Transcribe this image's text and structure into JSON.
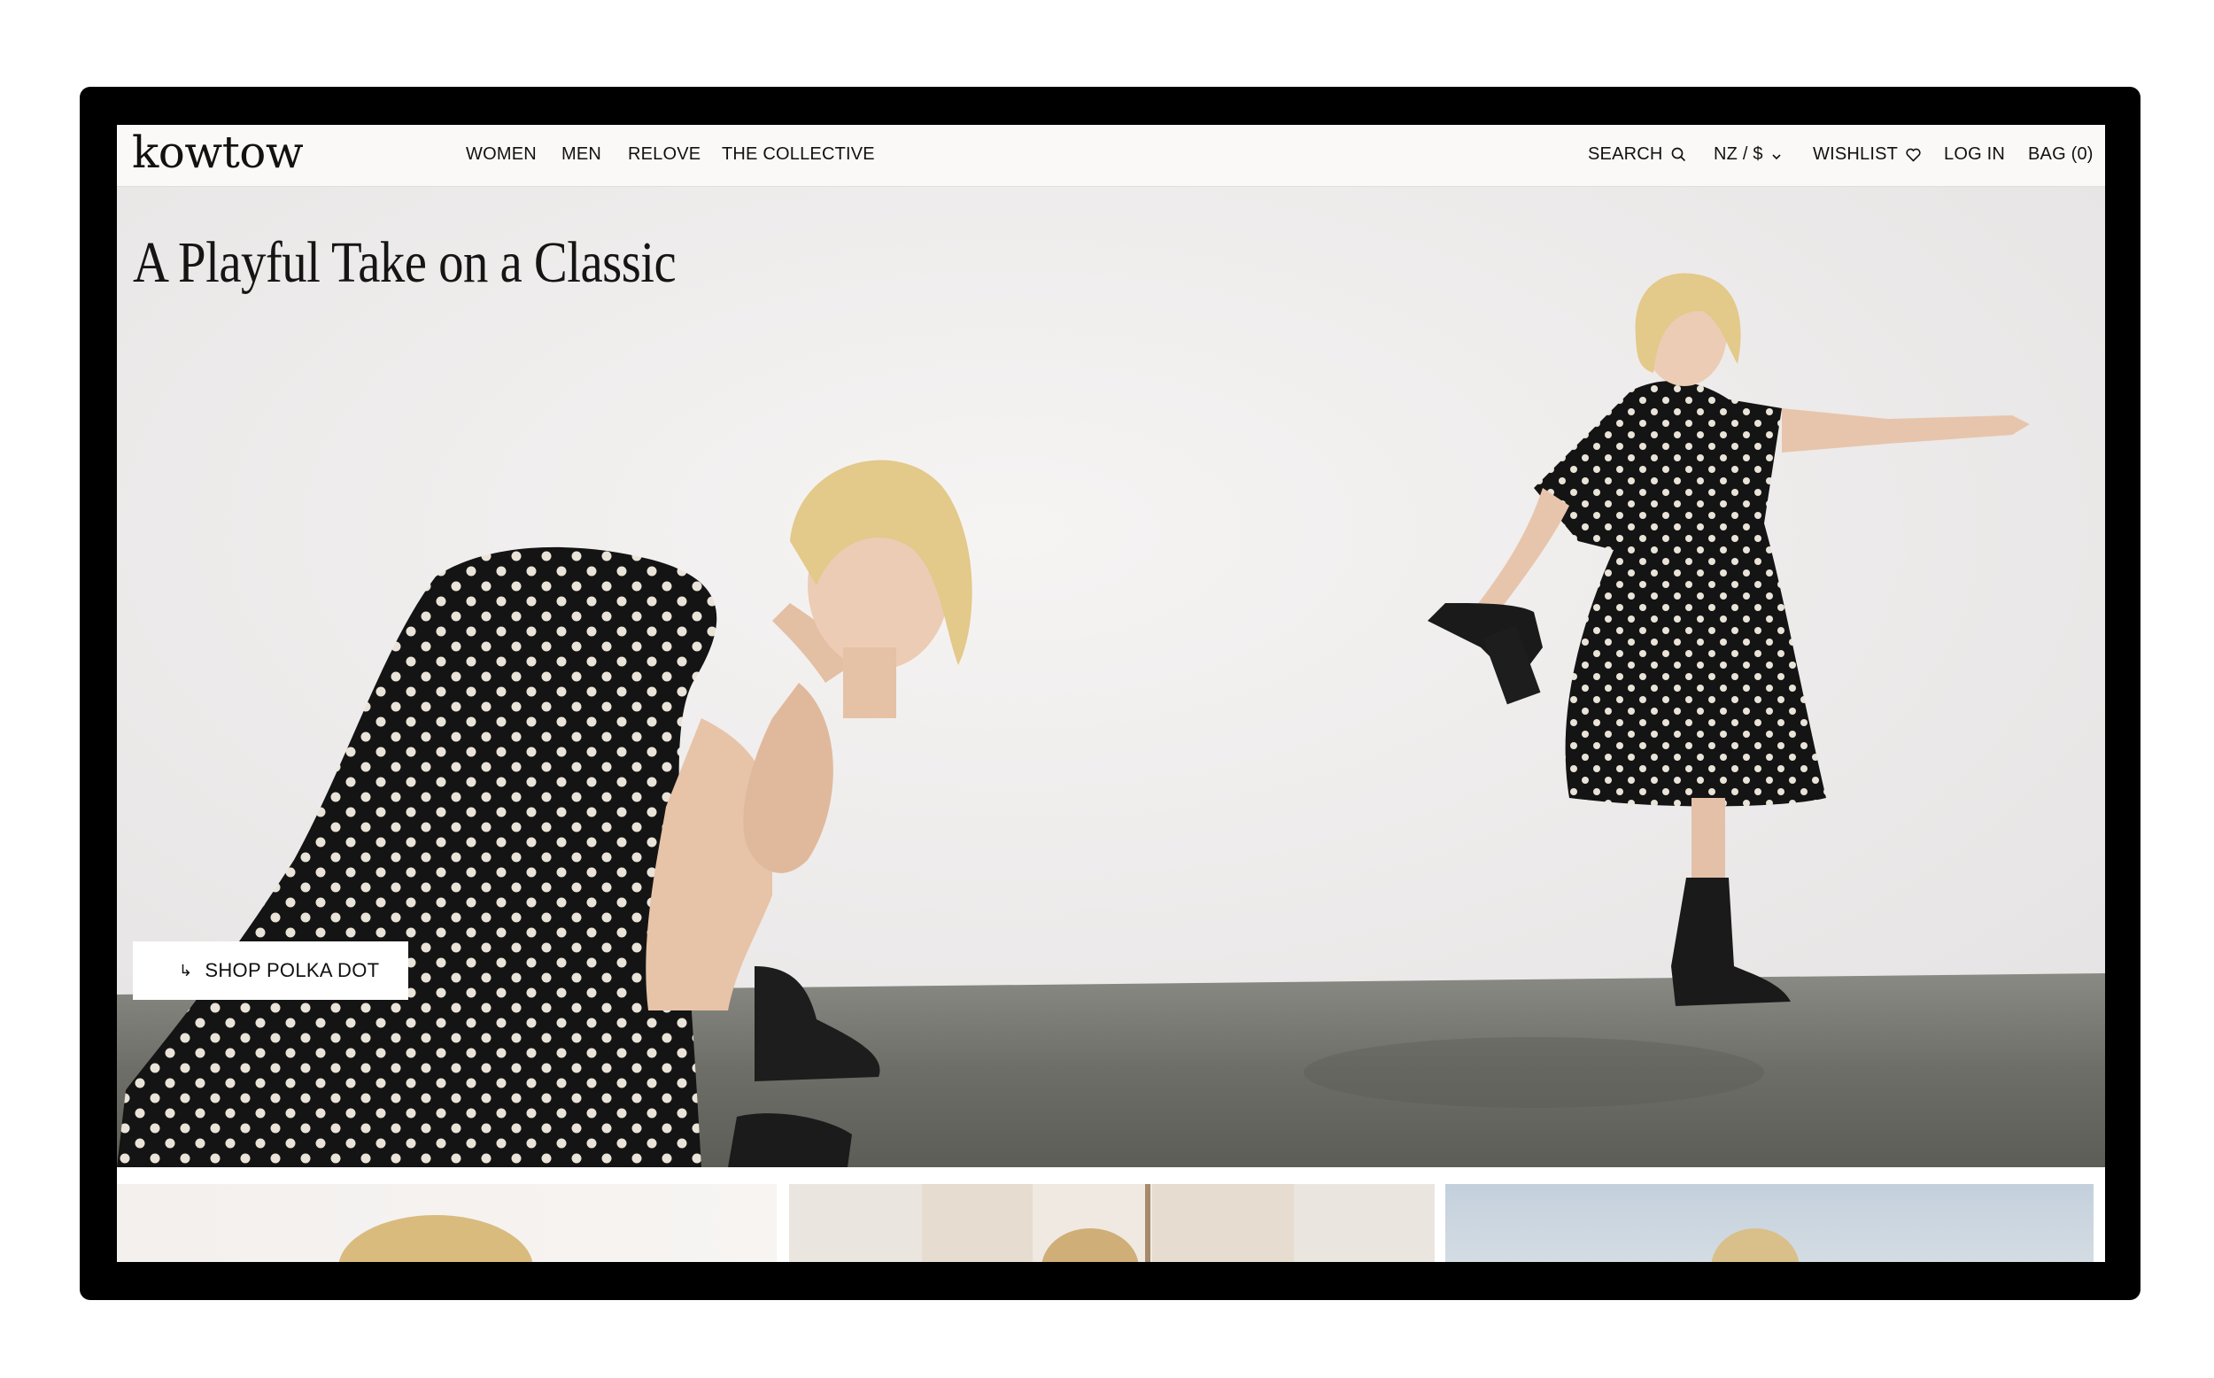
{
  "header": {
    "logo": "kowtow",
    "nav_left": [
      "WOMEN",
      "MEN",
      "RELOVE",
      "THE COLLECTIVE"
    ],
    "search_label": "SEARCH",
    "currency_label": "NZ / $",
    "wishlist_label": "WISHLIST",
    "login_label": "LOG IN",
    "bag_label": "BAG (0)"
  },
  "hero": {
    "headline": "A Playful Take on a Classic",
    "cta_arrow": "↳",
    "cta_label": "SHOP POLKA DOT"
  },
  "icons": [
    "search-icon",
    "chevron-down-icon",
    "heart-icon",
    "arrow-icon"
  ],
  "colors": {
    "nav_bg": "#faf9f7",
    "text": "#111111",
    "wall": "#efedec",
    "floor": "#6d6d67",
    "dress": "#111111",
    "dots": "#e9e3d8",
    "hair": "#e3c98a"
  }
}
